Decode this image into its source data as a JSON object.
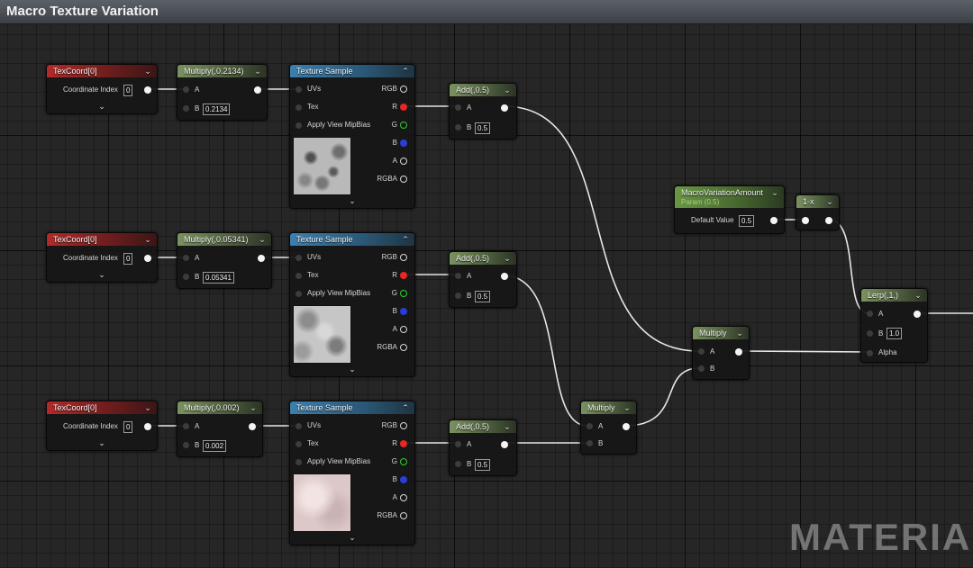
{
  "window": {
    "title": "Macro Texture Variation"
  },
  "watermark": "MATERIAL",
  "colors": {
    "texcoord": "#b22a2a",
    "math": "#7b9260",
    "texture": "#3d7fae",
    "param": "#6a9744",
    "pin_r": "#e82626",
    "pin_g": "#2ed02e",
    "pin_b": "#2b3dd8"
  },
  "texcoord_nodes": [
    {
      "title": "TexCoord[0]",
      "field_label": "Coordinate Index",
      "value": "0"
    },
    {
      "title": "TexCoord[0]",
      "field_label": "Coordinate Index",
      "value": "0"
    },
    {
      "title": "TexCoord[0]",
      "field_label": "Coordinate Index",
      "value": "0"
    }
  ],
  "multiply_scale_nodes": [
    {
      "title": "Multiply(,0.2134)",
      "in_a": "A",
      "in_b": "B",
      "b_value": "0.2134"
    },
    {
      "title": "Multiply(,0.05341)",
      "in_a": "A",
      "in_b": "B",
      "b_value": "0.05341"
    },
    {
      "title": "Multiply(,0.002)",
      "in_a": "A",
      "in_b": "B",
      "b_value": "0.002"
    }
  ],
  "texture_nodes": [
    {
      "title": "Texture Sample",
      "inputs": [
        "UVs",
        "Tex",
        "Apply View MipBias"
      ],
      "outputs": [
        "RGB",
        "R",
        "G",
        "B",
        "A",
        "RGBA"
      ]
    },
    {
      "title": "Texture Sample",
      "inputs": [
        "UVs",
        "Tex",
        "Apply View MipBias"
      ],
      "outputs": [
        "RGB",
        "R",
        "G",
        "B",
        "A",
        "RGBA"
      ]
    },
    {
      "title": "Texture Sample",
      "inputs": [
        "UVs",
        "Tex",
        "Apply View MipBias"
      ],
      "outputs": [
        "RGB",
        "R",
        "G",
        "B",
        "A",
        "RGBA"
      ]
    }
  ],
  "add_nodes": [
    {
      "title": "Add(,0.5)",
      "in_a": "A",
      "in_b": "B",
      "b_value": "0.5"
    },
    {
      "title": "Add(,0.5)",
      "in_a": "A",
      "in_b": "B",
      "b_value": "0.5"
    },
    {
      "title": "Add(,0.5)",
      "in_a": "A",
      "in_b": "B",
      "b_value": "0.5"
    }
  ],
  "multiply_nodes": [
    {
      "title": "Multiply",
      "in_a": "A",
      "in_b": "B"
    },
    {
      "title": "Multiply",
      "in_a": "A",
      "in_b": "B"
    }
  ],
  "param_node": {
    "title": "MacroVariationAmount",
    "subtitle": "Param (0.5)",
    "field_label": "Default Value",
    "value": "0.5"
  },
  "one_minus_node": {
    "title": "1-x"
  },
  "lerp_node": {
    "title": "Lerp(,1,)",
    "in_a": "A",
    "in_b": "B",
    "b_value": "1.0",
    "in_alpha": "Alpha"
  },
  "icons": {
    "collapse": "chevron-down-icon",
    "expand": "expand-arrow-icon"
  }
}
